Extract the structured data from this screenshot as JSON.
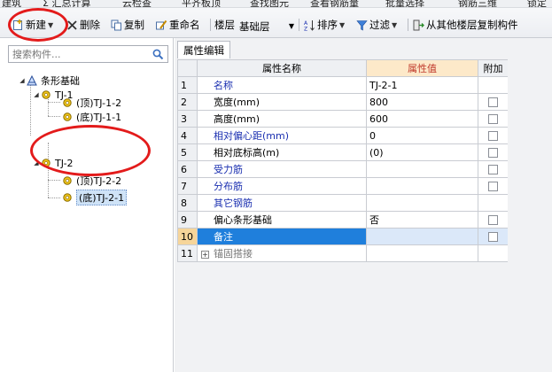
{
  "topstrip": {
    "items": [
      "建筑",
      "Σ 汇总计算",
      "云检查",
      "平齐板顶",
      "查找图元",
      "查看钢筋量",
      "批量选择",
      "钢筋三维",
      "锁定"
    ]
  },
  "toolbar": {
    "new_label": "新建",
    "delete_label": "删除",
    "copy_label": "复制",
    "rename_label": "重命名",
    "floor_label": "楼层",
    "floor_value": "基础层",
    "sort_label": "排序",
    "filter_label": "过滤",
    "copy_from_floor_label": "从其他楼层复制构件"
  },
  "search": {
    "placeholder": "搜索构件..."
  },
  "tree": {
    "root": "条形基础",
    "groups": [
      {
        "label": "TJ-1",
        "children": [
          "(顶)TJ-1-2",
          "(底)TJ-1-1"
        ]
      },
      {
        "label": "TJ-2",
        "children": [
          "(顶)TJ-2-2",
          "(底)TJ-2-1"
        ]
      }
    ]
  },
  "properties": {
    "tab_label": "属性编辑",
    "headers": [
      "属性名称",
      "属性值",
      "附加"
    ],
    "rows": [
      {
        "num": "1",
        "name": "名称",
        "value": "TJ-2-1",
        "extra": false,
        "style": "blue",
        "checkbox": false
      },
      {
        "num": "2",
        "name": "宽度(mm)",
        "value": "800",
        "extra": false,
        "style": "black",
        "checkbox": true
      },
      {
        "num": "3",
        "name": "高度(mm)",
        "value": "600",
        "extra": false,
        "style": "black",
        "checkbox": true
      },
      {
        "num": "4",
        "name": "相对偏心距(mm)",
        "value": "0",
        "extra": false,
        "style": "blue",
        "checkbox": true
      },
      {
        "num": "5",
        "name": "相对底标高(m)",
        "value": "(0)",
        "extra": false,
        "style": "black",
        "checkbox": true
      },
      {
        "num": "6",
        "name": "受力筋",
        "value": "",
        "extra": false,
        "style": "blue",
        "checkbox": true
      },
      {
        "num": "7",
        "name": "分布筋",
        "value": "",
        "extra": false,
        "style": "blue",
        "checkbox": true
      },
      {
        "num": "8",
        "name": "其它钢筋",
        "value": "",
        "extra": false,
        "style": "blue",
        "checkbox": false
      },
      {
        "num": "9",
        "name": "偏心条形基础",
        "value": "否",
        "extra": false,
        "style": "black",
        "checkbox": true
      },
      {
        "num": "10",
        "name": "备注",
        "value": "",
        "extra": false,
        "style": "active",
        "checkbox": true
      },
      {
        "num": "11",
        "name": "锚固搭接",
        "value": "",
        "extra": false,
        "style": "gray",
        "checkbox": false
      }
    ]
  },
  "colors": {
    "annotation_red": "#e31b1b",
    "value_header_bg": "#fde9c9",
    "active_row_blue": "#1f7fdc"
  }
}
